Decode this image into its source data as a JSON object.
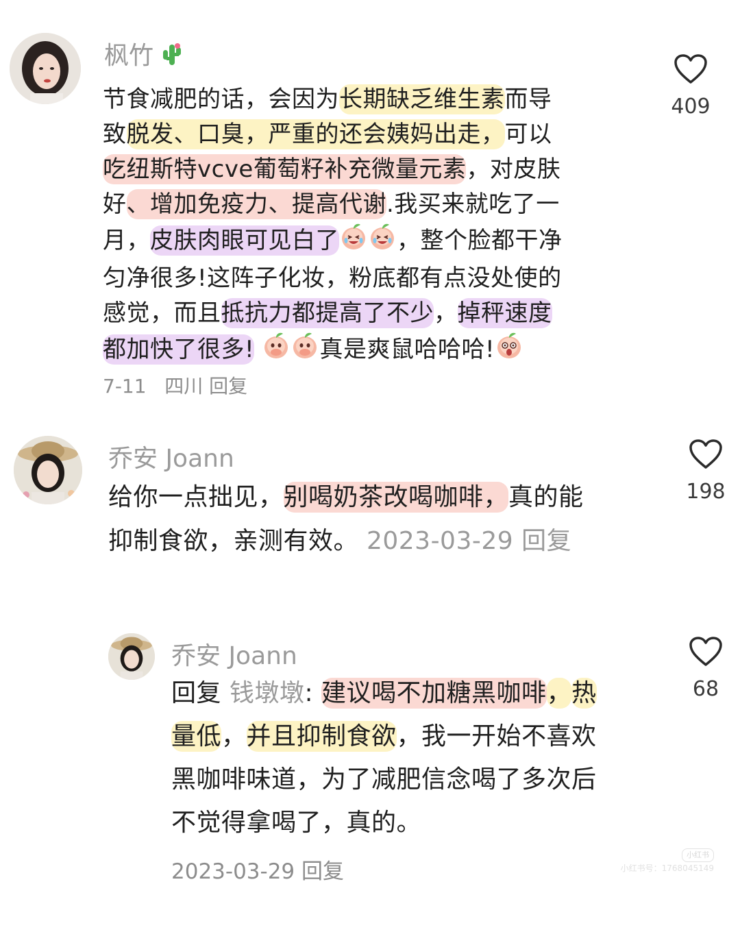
{
  "comments": [
    {
      "username": "枫竹",
      "lines": [
        [
          {
            "t": "节食减肥的话，会因为"
          },
          {
            "t": "长期缺乏维生素",
            "hl": "y"
          },
          {
            "t": "而导"
          }
        ],
        [
          {
            "t": "致"
          },
          {
            "t": "脱发、口臭，严重的还会姨妈出走，",
            "hl": "y"
          },
          {
            "t": "可以"
          }
        ],
        [
          {
            "t": "吃纽斯特vcve葡萄籽补充微量元素",
            "hl": "p"
          },
          {
            "t": "，对皮肤"
          }
        ],
        [
          {
            "t": "好"
          },
          {
            "t": "、增加免疫力、提高代谢",
            "hl": "p"
          },
          {
            "t": ".我买来就吃了一"
          }
        ],
        [
          {
            "t": "月，"
          },
          {
            "t": "皮肤肉眼可见白了",
            "hl": "v"
          },
          {
            "e": "emo-laugh-cry-icon"
          },
          {
            "e": "emo-laugh-cry-icon"
          },
          {
            "t": "，整个脸都干净"
          }
        ],
        [
          {
            "t": "匀净很多!这阵子化妆，粉底都有点没处使的"
          }
        ],
        [
          {
            "t": "感觉，而且"
          },
          {
            "t": "抵抗力都提高了不少",
            "hl": "v"
          },
          {
            "t": "，"
          },
          {
            "t": "掉秤速度",
            "hl": "v"
          }
        ],
        [
          {
            "t": "都加快了很多!",
            "hl": "v"
          },
          {
            "t": " "
          },
          {
            "e": "emo-cover-mouth-icon"
          },
          {
            "e": "emo-cover-mouth-icon"
          },
          {
            "t": "真是爽鼠哈哈哈!"
          },
          {
            "e": "emo-surprised-icon"
          }
        ]
      ],
      "date": "7-11",
      "location": "四川",
      "reply_label": "回复",
      "likes": "409"
    },
    {
      "username": "乔安 Joann",
      "lines": [
        [
          {
            "t": "给你一点拙见，"
          },
          {
            "t": "别喝奶茶改喝咖啡，",
            "hl": "p"
          },
          {
            "t": "真的能"
          }
        ],
        [
          {
            "t": "抑制食欲，亲测有效。 "
          },
          {
            "t": "2023-03-29 回复",
            "muted": true
          }
        ]
      ],
      "likes": "198"
    },
    {
      "username": "乔安 Joann",
      "lines": [
        [
          {
            "t": "回复 "
          },
          {
            "t": "钱墩墩",
            "muted": true
          },
          {
            "t": ": "
          },
          {
            "t": "建议喝不加糖黑咖啡",
            "hl": "p"
          },
          {
            "t": "，",
            "hl": "y"
          },
          {
            "t": "热",
            "hl": "y"
          }
        ],
        [
          {
            "t": "量低",
            "hl": "y"
          },
          {
            "t": "，"
          },
          {
            "t": "并且抑制食欲",
            "hl": "y"
          },
          {
            "t": "，我一开始不喜欢"
          }
        ],
        [
          {
            "t": "黑咖啡味道，为了减肥信念喝了多次后"
          }
        ],
        [
          {
            "t": "不觉得拿喝了，真的。"
          }
        ]
      ],
      "date": "2023-03-29",
      "reply_label": "回复",
      "likes": "68"
    }
  ],
  "watermark": {
    "badge": "小红书",
    "id_text": "小红书号：1768045149"
  },
  "colors": {
    "highlight_yellow": "#fdf3c4",
    "highlight_pink": "#fbd9d3",
    "highlight_purple": "#ecd6f6"
  }
}
